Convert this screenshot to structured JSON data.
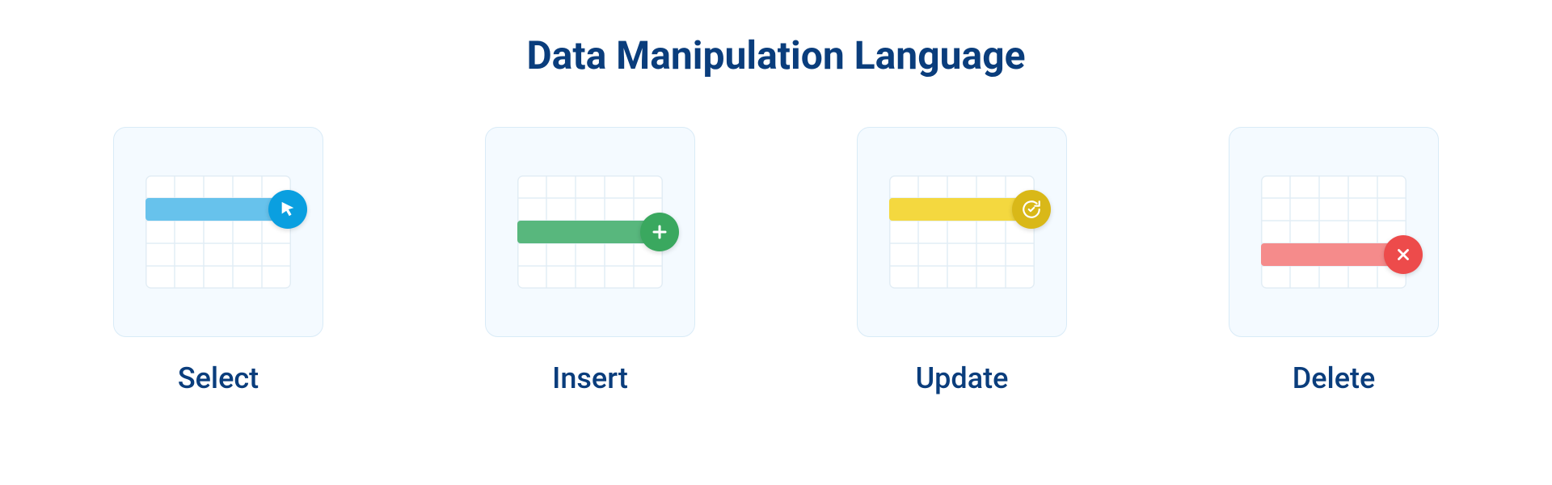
{
  "title": "Data Manipulation Language",
  "operations": [
    {
      "label": "Select",
      "icon": "cursor-icon",
      "color": "#0a9fe0",
      "rowColor": "#67c2ec",
      "rowClass": "row-select",
      "badgeClass": "badge-select"
    },
    {
      "label": "Insert",
      "icon": "plus-icon",
      "color": "#3aa85f",
      "rowColor": "#58b77d",
      "rowClass": "row-insert",
      "badgeClass": "badge-insert"
    },
    {
      "label": "Update",
      "icon": "refresh-check-icon",
      "color": "#d9b818",
      "rowColor": "#f4d83f",
      "rowClass": "row-update",
      "badgeClass": "badge-update"
    },
    {
      "label": "Delete",
      "icon": "close-icon",
      "color": "#ed4b4b",
      "rowColor": "#f58b8b",
      "rowClass": "row-delete",
      "badgeClass": "badge-delete"
    }
  ]
}
